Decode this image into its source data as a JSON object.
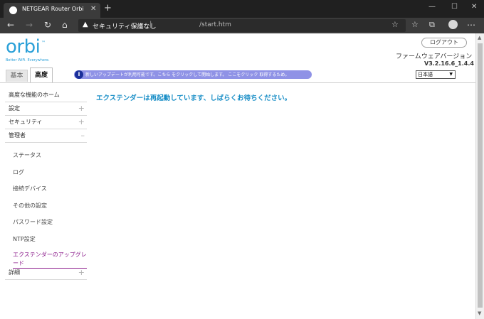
{
  "browser": {
    "tab_title": "NETGEAR Router Orbi",
    "tab_close": "✕",
    "new_tab": "+",
    "security_label": "セキュリティ保護なし",
    "url_path": "/start.htm"
  },
  "header": {
    "logo": "orbi",
    "tagline": "Better WiFi. Everywhere.",
    "logout_label": "ログアウト",
    "firmware_label": "ファームウェアバージョン",
    "firmware_version": "V3.2.16.6_1.4.4"
  },
  "tabs": {
    "basic": "基本",
    "advanced": "高度"
  },
  "update_banner": {
    "text": "新しいアップデートが利用可能です。こちら をクリックして開始します。 ここをクリック 取得するため。"
  },
  "language": {
    "selected": "日本語"
  },
  "sidebar": {
    "items": [
      {
        "label": "高度な機能のホーム",
        "expander": ""
      },
      {
        "label": "設定",
        "expander": "+"
      },
      {
        "label": "セキュリティ",
        "expander": "+"
      },
      {
        "label": "管理者",
        "expander": "–"
      }
    ],
    "admin_sub": [
      {
        "label": "ステータス"
      },
      {
        "label": "ログ"
      },
      {
        "label": "接続デバイス"
      },
      {
        "label": "その他の設定"
      },
      {
        "label": "パスワード設定"
      },
      {
        "label": "NTP設定"
      }
    ],
    "active_sub": "エクステンダーのアップグレード",
    "details": {
      "label": "詳細",
      "expander": "+"
    }
  },
  "main": {
    "message": "エクステンダーは再起動しています、しばらくお待ちください。"
  }
}
